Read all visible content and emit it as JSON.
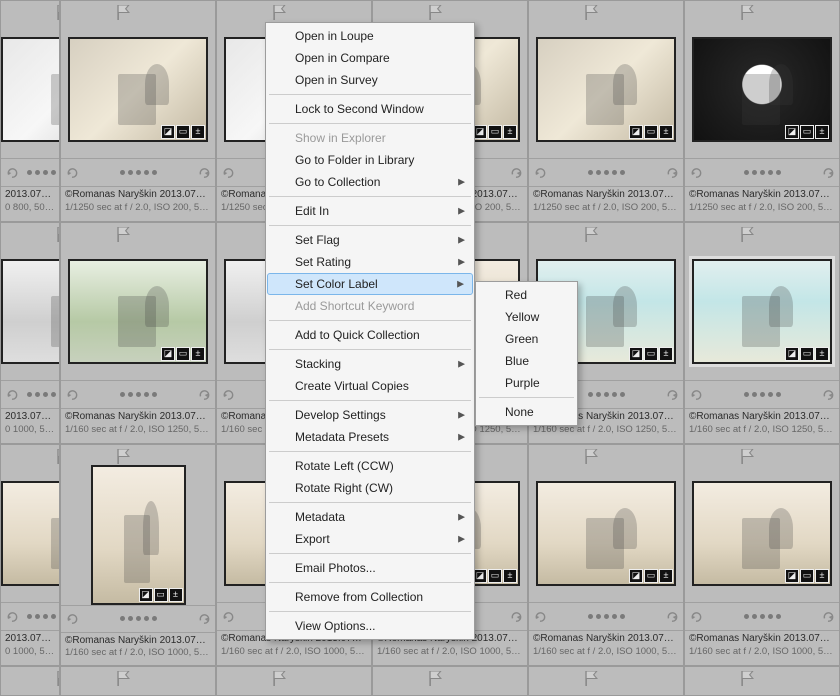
{
  "meta_common": {
    "copyright": "©Romanas Naryškin",
    "date": "2013.07"
  },
  "rows": [
    {
      "settings": "1/1250 sec at f / 2.0, ISO 200, 50 ...",
      "settings_short": "0 800, 50 ..."
    },
    {
      "settings": "1/160 sec at f / 2.0, ISO 1250, 50 ...",
      "settings_short": "0 1000, 50 ..."
    },
    {
      "settings": "1/160 sec at f / 2.0, ISO 1000, 50 ...",
      "settings_short": "0 1000, 50 ..."
    },
    {
      "settings_short": " "
    }
  ],
  "thumbs": [
    [
      "p-indoor-bw",
      "p-indoor",
      "p-indoor-bw",
      "p-indoor",
      "p-indoor",
      "p-window"
    ],
    [
      "p-outdoor-bw",
      "p-outdoor",
      "p-outdoor-bw",
      "p-church",
      "p-church2",
      "p-church2"
    ],
    [
      "p-church",
      "p-church",
      "p-church",
      "p-church",
      "p-church",
      "p-church"
    ]
  ],
  "context_menu": [
    {
      "type": "item",
      "label": "Open in Loupe"
    },
    {
      "type": "item",
      "label": "Open in Compare"
    },
    {
      "type": "item",
      "label": "Open in Survey"
    },
    {
      "type": "sep"
    },
    {
      "type": "item",
      "label": "Lock to Second Window"
    },
    {
      "type": "sep"
    },
    {
      "type": "item",
      "label": "Show in Explorer",
      "disabled": true
    },
    {
      "type": "item",
      "label": "Go to Folder in Library"
    },
    {
      "type": "item",
      "label": "Go to Collection",
      "submenu": true
    },
    {
      "type": "sep"
    },
    {
      "type": "item",
      "label": "Edit In",
      "submenu": true
    },
    {
      "type": "sep"
    },
    {
      "type": "item",
      "label": "Set Flag",
      "submenu": true
    },
    {
      "type": "item",
      "label": "Set Rating",
      "submenu": true
    },
    {
      "type": "item",
      "label": "Set Color Label",
      "submenu": true,
      "highlight": true
    },
    {
      "type": "item",
      "label": "Add Shortcut Keyword",
      "disabled": true
    },
    {
      "type": "sep"
    },
    {
      "type": "item",
      "label": "Add to Quick Collection"
    },
    {
      "type": "sep"
    },
    {
      "type": "item",
      "label": "Stacking",
      "submenu": true
    },
    {
      "type": "item",
      "label": "Create Virtual Copies"
    },
    {
      "type": "sep"
    },
    {
      "type": "item",
      "label": "Develop Settings",
      "submenu": true
    },
    {
      "type": "item",
      "label": "Metadata Presets",
      "submenu": true
    },
    {
      "type": "sep"
    },
    {
      "type": "item",
      "label": "Rotate Left (CCW)"
    },
    {
      "type": "item",
      "label": "Rotate Right (CW)"
    },
    {
      "type": "sep"
    },
    {
      "type": "item",
      "label": "Metadata",
      "submenu": true
    },
    {
      "type": "item",
      "label": "Export",
      "submenu": true
    },
    {
      "type": "sep"
    },
    {
      "type": "item",
      "label": "Email Photos..."
    },
    {
      "type": "sep"
    },
    {
      "type": "item",
      "label": "Remove from Collection"
    },
    {
      "type": "sep"
    },
    {
      "type": "item",
      "label": "View Options..."
    }
  ],
  "color_submenu": [
    "Red",
    "Yellow",
    "Green",
    "Blue",
    "Purple",
    "__sep__",
    "None"
  ]
}
